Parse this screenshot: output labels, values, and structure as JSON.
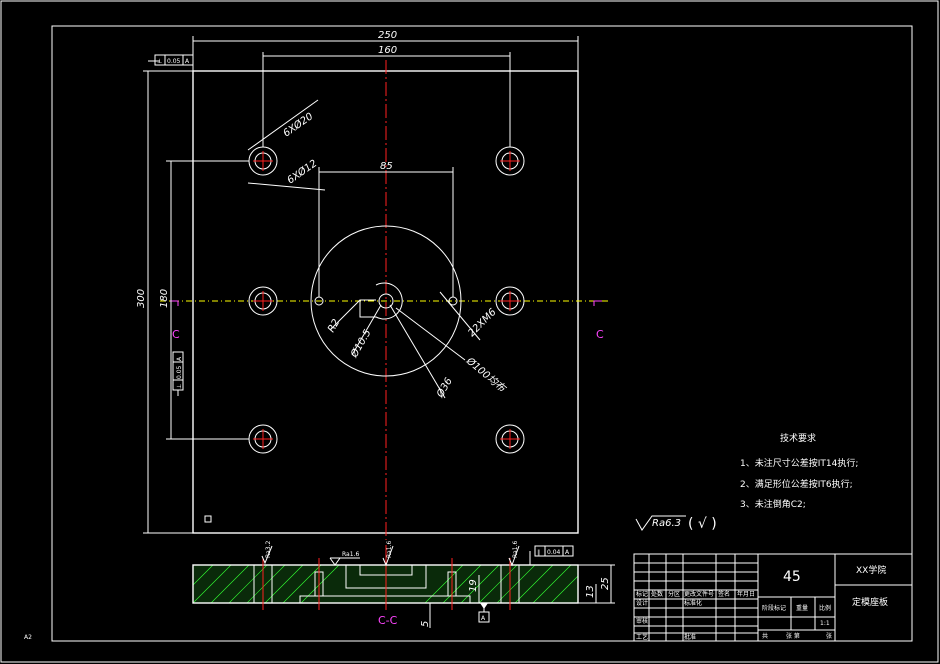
{
  "sheet_size": "A2",
  "dimensions": {
    "overall_width": "250",
    "hole_spacing_x": "160",
    "center_spacing": "85",
    "overall_height": "300",
    "hole_spacing_y": "180",
    "counterbore": "6XØ20",
    "through_hole": "6XØ12",
    "radius": "R2",
    "center_hole": "Ø10.5",
    "bore": "Ø36",
    "fit": "22XM6",
    "bolt_circle": "Ø100均布",
    "thickness": "25",
    "step_depth": "13",
    "pocket_depth": "5",
    "pin_height": "19"
  },
  "tolerance_frames": {
    "top_left": [
      "⊥",
      "0.05",
      "A"
    ],
    "left_side": [
      "⊥",
      "0.05",
      "A"
    ],
    "section_top": [
      "∥",
      "0.04",
      "A"
    ]
  },
  "roughness": {
    "ra_a": "Ra3.2",
    "ra_b": "Ra1.6",
    "ra_c": "Ra1.6",
    "ra_d": "Ra1.6",
    "general": "Ra6.3",
    "general_suffix": "( √ )"
  },
  "section_marks": {
    "left": "C",
    "right": "C",
    "label": "C-C"
  },
  "datum": "A",
  "technical_requirements": {
    "title": "技术要求",
    "items": [
      "1、未注尺寸公差按IT14执行;",
      "2、满足形位公差按IT6执行;",
      "3、未注倒角C2;"
    ]
  },
  "title_block": {
    "material": "45",
    "school": "XX学院",
    "part_name": "定模座板",
    "scale": "1:1",
    "row_labels": [
      "标记",
      "设计",
      "审核",
      "工艺"
    ],
    "col_labels": [
      "处数",
      "分区",
      "更改文件号",
      "签名",
      "年月日"
    ],
    "std_label": "标准化",
    "approve_label": "批准",
    "stage_label": "阶段标记",
    "weight_label": "重量",
    "scale_label": "比例",
    "sheets_label": "共",
    "sheet_no_label": "张 第",
    "sheet_end_label": "张"
  }
}
